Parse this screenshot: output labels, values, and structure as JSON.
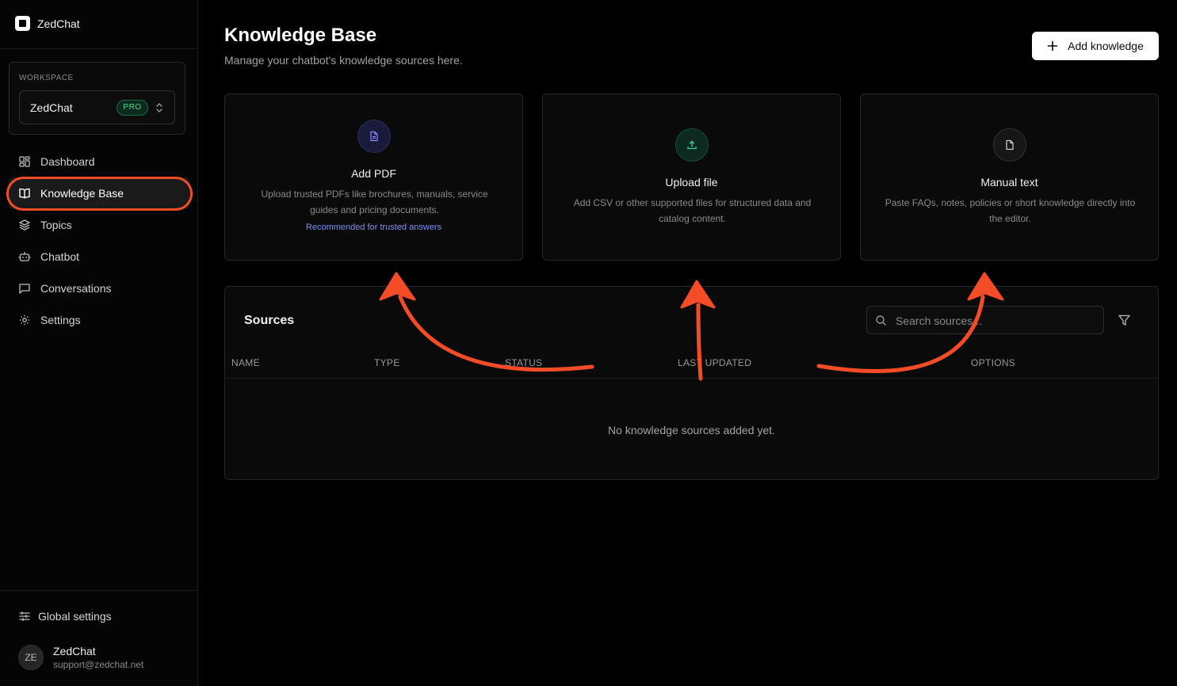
{
  "app": {
    "name": "ZedChat"
  },
  "workspace": {
    "label": "WORKSPACE",
    "name": "ZedChat",
    "badge": "PRO"
  },
  "nav": {
    "items": [
      {
        "label": "Dashboard",
        "icon": "dashboard-icon"
      },
      {
        "label": "Knowledge Base",
        "icon": "book-open-icon",
        "active": true
      },
      {
        "label": "Topics",
        "icon": "layers-icon"
      },
      {
        "label": "Chatbot",
        "icon": "bot-icon"
      },
      {
        "label": "Conversations",
        "icon": "message-square-icon"
      },
      {
        "label": "Settings",
        "icon": "gear-icon"
      }
    ]
  },
  "footer": {
    "global_settings": "Global settings",
    "user": {
      "initials": "ZE",
      "name": "ZedChat",
      "email": "support@zedchat.net"
    }
  },
  "header": {
    "title": "Knowledge Base",
    "subtitle": "Manage your chatbot's knowledge sources here.",
    "add_button": "Add knowledge"
  },
  "cards": [
    {
      "title": "Add PDF",
      "description": "Upload trusted PDFs like brochures, manuals, service guides and pricing documents.",
      "note": "Recommended for trusted answers",
      "icon": "file-text-icon",
      "accent": "#818cf8"
    },
    {
      "title": "Upload file",
      "description": "Add CSV or other supported files for structured data and catalog content.",
      "icon": "upload-icon",
      "accent": "#34d399"
    },
    {
      "title": "Manual text",
      "description": "Paste FAQs, notes, policies or short knowledge directly into the editor.",
      "icon": "file-icon",
      "accent": "#d4d4d4"
    }
  ],
  "sources": {
    "title": "Sources",
    "search_placeholder": "Search sources...",
    "columns": [
      "NAME",
      "TYPE",
      "STATUS",
      "LAST UPDATED",
      "OPTIONS"
    ],
    "empty_message": "No knowledge sources added yet."
  },
  "colors": {
    "annotation": "#f44c26",
    "background": "#000000",
    "panel": "#0a0a0b"
  }
}
